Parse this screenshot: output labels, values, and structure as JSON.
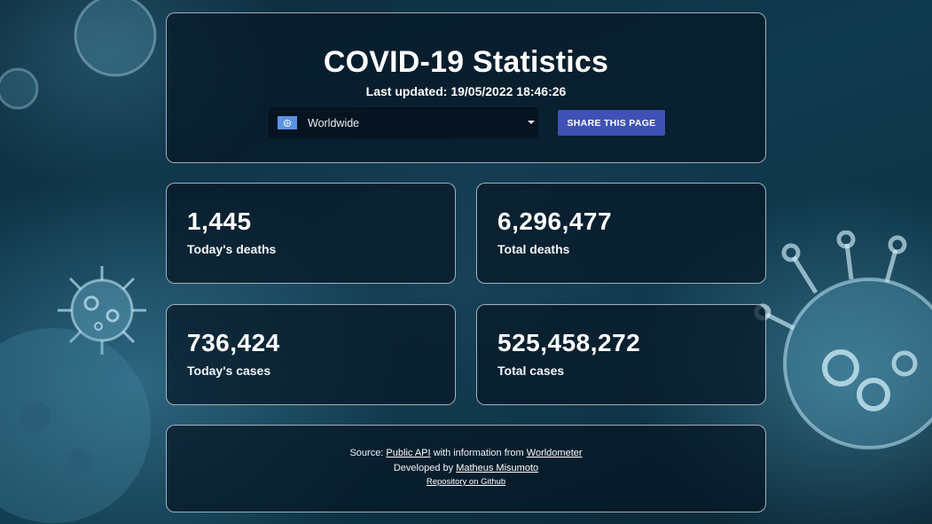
{
  "header": {
    "title": "COVID-19 Statistics",
    "last_updated": "Last updated: 19/05/2022 18:46:26"
  },
  "country_select": {
    "selected": "Worldwide",
    "flag_icon": "united-nations-flag-icon"
  },
  "share_button": {
    "label": "SHARE THIS PAGE"
  },
  "stats": {
    "today_deaths": {
      "value": "1,445",
      "label": "Today's deaths"
    },
    "total_deaths": {
      "value": "6,296,477",
      "label": "Total deaths"
    },
    "today_cases": {
      "value": "736,424",
      "label": "Today's cases"
    },
    "total_cases": {
      "value": "525,458,272",
      "label": "Total cases"
    }
  },
  "footer": {
    "source_prefix": "Source: ",
    "source_link": "Public API",
    "source_middle": " with information from ",
    "source_site": "Worldometer",
    "developed_prefix": "Developed by ",
    "developer": "Matheus Misumoto",
    "repo_link": "Repository on Github"
  },
  "colors": {
    "button": "#3f51b5",
    "panel_border": "#d2e1eb",
    "background": "#103a4f"
  }
}
